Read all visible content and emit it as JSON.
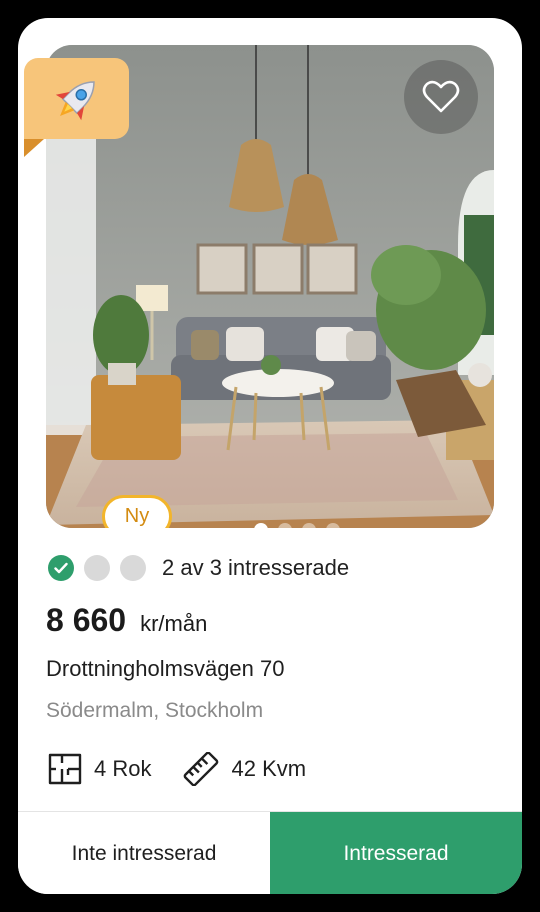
{
  "listing": {
    "badge_new": "Ny",
    "interest": {
      "text": "2 av 3 intresserade",
      "checked_count": 1,
      "total_indicators": 3
    },
    "price": "8 660",
    "price_unit": "kr/mån",
    "address": "Drottningholmsvägen 70",
    "area": "Södermalm, Stockholm",
    "rooms": "4 Rok",
    "size": "42 Kvm",
    "carousel": {
      "count": 4,
      "active": 1
    }
  },
  "actions": {
    "not_interested": "Inte intresserad",
    "interested": "Intresserad"
  },
  "icons": {
    "boost": "rocket-icon",
    "favorite": "heart-icon",
    "check": "check-icon",
    "rooms": "floorplan-icon",
    "size": "ruler-icon"
  },
  "colors": {
    "accent": "#2e9e6c",
    "badge_border": "#f2b52b",
    "boost_tag": "#f7c57a"
  }
}
